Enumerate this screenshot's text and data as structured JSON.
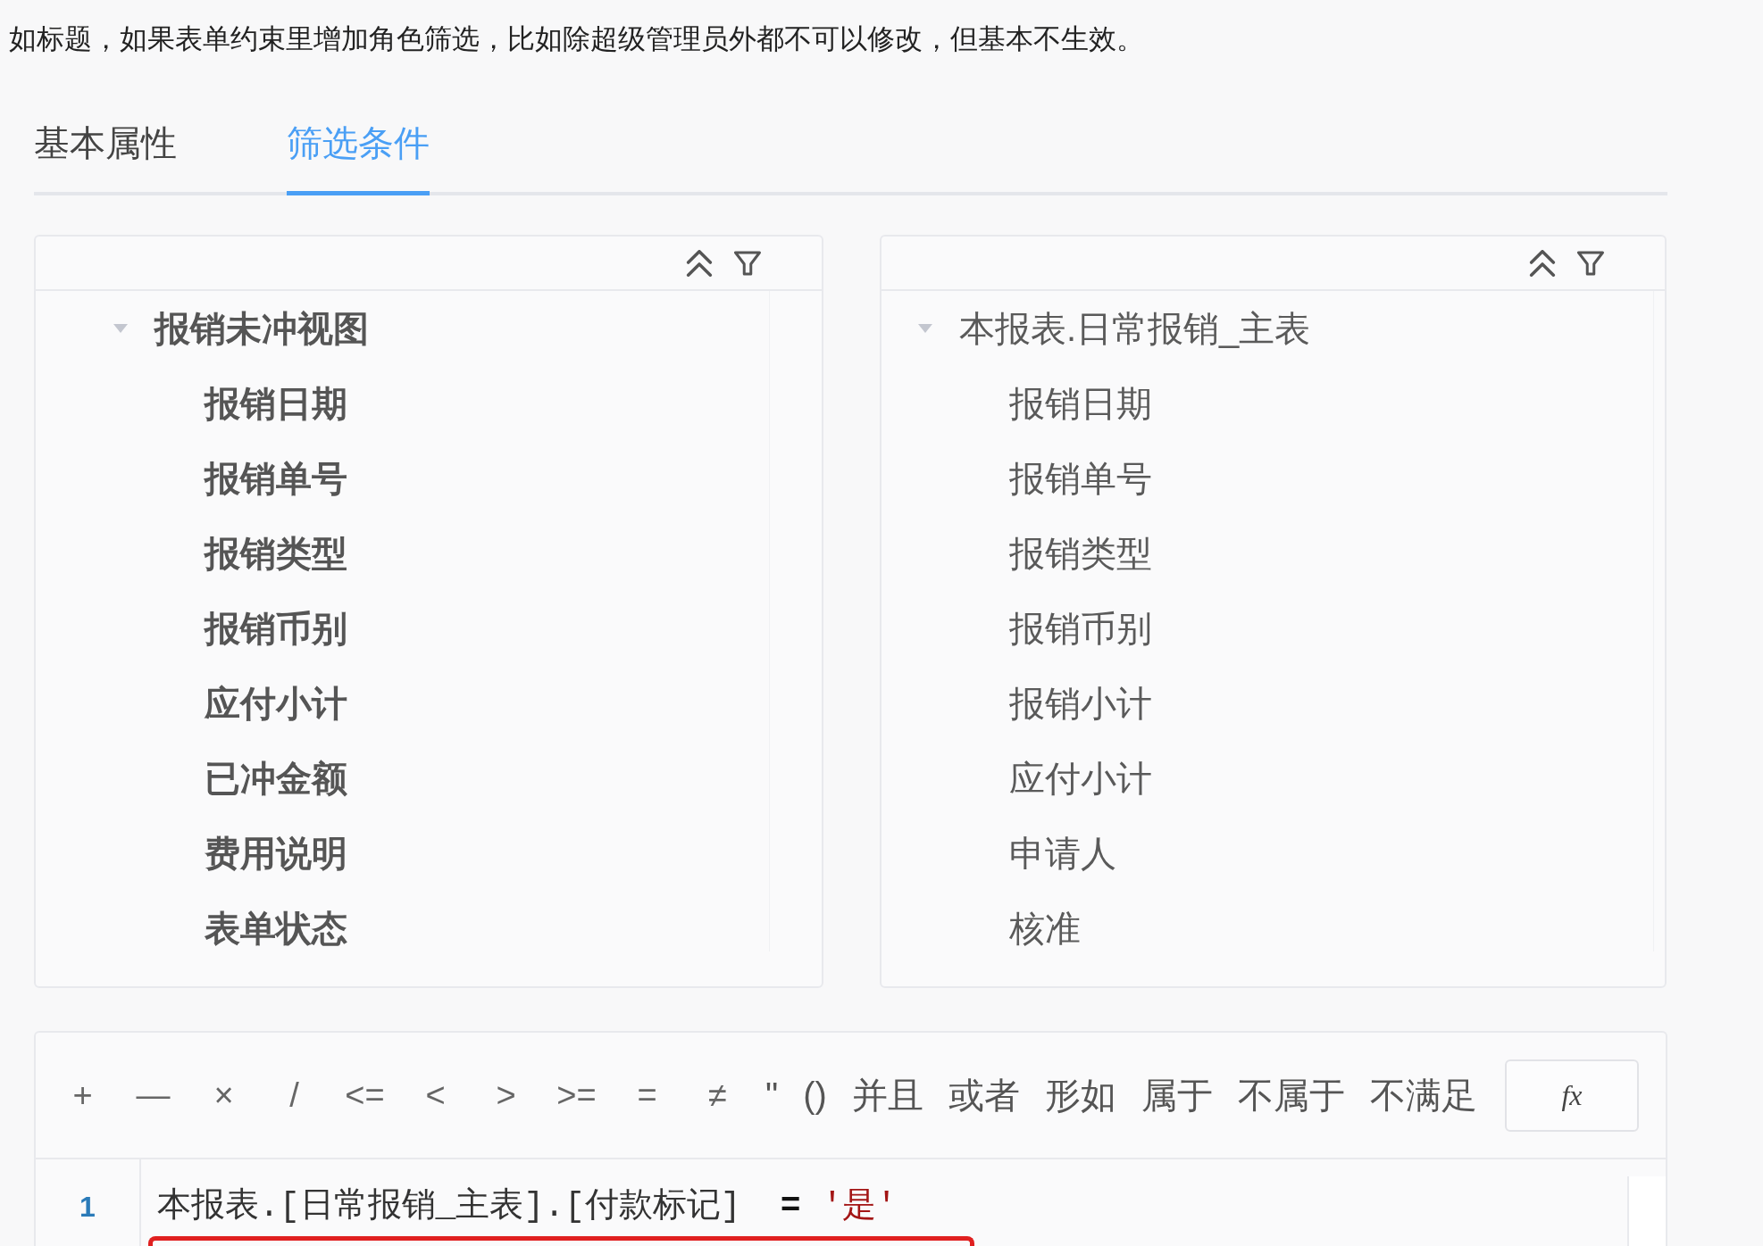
{
  "post": {
    "text": "如标题，如果表单约束里增加角色筛选，比如除超级管理员外都不可以修改，但基本不生效。"
  },
  "tabs": [
    {
      "label": "基本属性",
      "selected": false
    },
    {
      "label": "筛选条件",
      "selected": true
    }
  ],
  "field_panels": [
    {
      "tree": [
        {
          "label": "报销未冲视图",
          "expanded": true,
          "children": [
            {
              "label": "报销日期"
            },
            {
              "label": "报销单号"
            },
            {
              "label": "报销类型"
            },
            {
              "label": "报销币别"
            },
            {
              "label": "应付小计"
            },
            {
              "label": "已冲金额"
            },
            {
              "label": "费用说明"
            },
            {
              "label": "表单状态"
            }
          ]
        }
      ]
    },
    {
      "tree": [
        {
          "label": "本报表.日常报销_主表",
          "expanded": true,
          "children": [
            {
              "label": "报销日期"
            },
            {
              "label": "报销单号"
            },
            {
              "label": "报销类型"
            },
            {
              "label": "报销币别"
            },
            {
              "label": "报销小计"
            },
            {
              "label": "应付小计"
            },
            {
              "label": "申请人"
            },
            {
              "label": "核准"
            }
          ]
        }
      ]
    }
  ],
  "operator_toolbar": {
    "operators": [
      {
        "kind": "symbol",
        "label": "+"
      },
      {
        "kind": "symbol",
        "label": "—"
      },
      {
        "kind": "symbol",
        "label": "×"
      },
      {
        "kind": "symbol",
        "label": "/"
      },
      {
        "kind": "symbol",
        "label": "<="
      },
      {
        "kind": "symbol",
        "label": "<"
      },
      {
        "kind": "symbol",
        "label": ">"
      },
      {
        "kind": "symbol",
        "label": ">="
      },
      {
        "kind": "symbol",
        "label": "="
      },
      {
        "kind": "symbol",
        "label": "≠"
      },
      {
        "kind": "text",
        "label": "\""
      },
      {
        "kind": "text",
        "label": "()"
      },
      {
        "kind": "text",
        "label": "并且"
      },
      {
        "kind": "text",
        "label": "或者"
      },
      {
        "kind": "text",
        "label": "形如"
      },
      {
        "kind": "text",
        "label": "属于"
      },
      {
        "kind": "text",
        "label": "不属于"
      },
      {
        "kind": "text",
        "label": "不满足"
      }
    ],
    "function_button": "fx"
  },
  "editor": {
    "lines": [
      {
        "number": "1",
        "tokens": [
          {
            "kind": "text",
            "text": "本报表.[日常报销_主表].[付款标记]"
          },
          {
            "kind": "operator",
            "text": "="
          },
          {
            "kind": "string",
            "text": "'是'"
          }
        ]
      }
    ]
  }
}
